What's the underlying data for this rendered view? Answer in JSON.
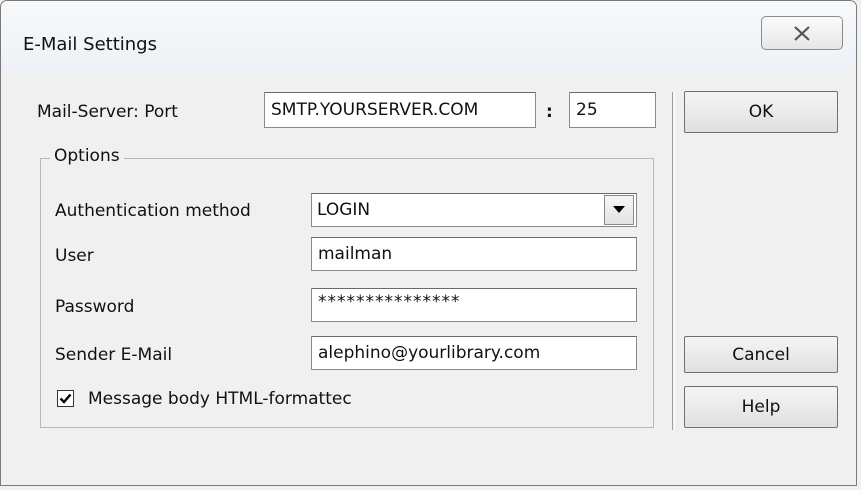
{
  "window": {
    "title": "E-Mail Settings",
    "close_icon": "close-x-icon"
  },
  "server": {
    "label": "Mail-Server: Port",
    "host_value": "SMTP.YOURSERVER.COM",
    "separator": ":",
    "port_value": "25"
  },
  "options": {
    "legend": "Options",
    "auth_label": "Authentication method",
    "auth_value": "LOGIN",
    "user_label": "User",
    "user_value": "mailman",
    "password_label": "Password",
    "password_value": "***************",
    "sender_label": "Sender E-Mail",
    "sender_value": "alephino@yourlibrary.com",
    "html_checkbox_label": "Message body HTML-formattec",
    "html_checkbox_checked": true
  },
  "buttons": {
    "ok": "OK",
    "cancel": "Cancel",
    "help": "Help"
  }
}
